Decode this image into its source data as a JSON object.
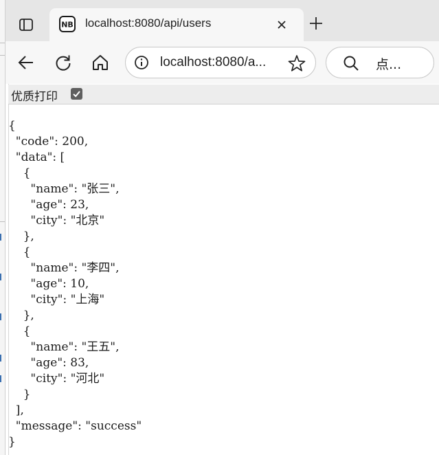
{
  "tab": {
    "title": "localhost:8080/api/users",
    "favicon": "NB"
  },
  "address_bar": {
    "url_display": "localhost:8080/a..."
  },
  "search_box": {
    "placeholder": "点..."
  },
  "pretty_print": {
    "label": "优质打印",
    "checked": true
  },
  "json_text": "{\n  \"code\": 200,\n  \"data\": [\n    {\n      \"name\": \"张三\",\n      \"age\": 23,\n      \"city\": \"北京\"\n    },\n    {\n      \"name\": \"李四\",\n      \"age\": 10,\n      \"city\": \"上海\"\n    },\n    {\n      \"name\": \"王五\",\n      \"age\": 83,\n      \"city\": \"河北\"\n    }\n  ],\n  \"message\": \"success\"\n}",
  "icons": {
    "sidebar": "sidebar-toggle-icon",
    "close": "close-icon",
    "new_tab": "plus-icon",
    "back": "back-arrow-icon",
    "refresh": "refresh-icon",
    "home": "home-icon",
    "info": "info-icon",
    "favorite": "star-icon",
    "search": "search-icon",
    "checkbox": "checkmark-icon"
  },
  "colors": {
    "tabstrip": "#e6e6e6",
    "toolbar": "#f7f7f7",
    "pretty_print_bar": "#ededed",
    "text": "#1a1a1a"
  }
}
